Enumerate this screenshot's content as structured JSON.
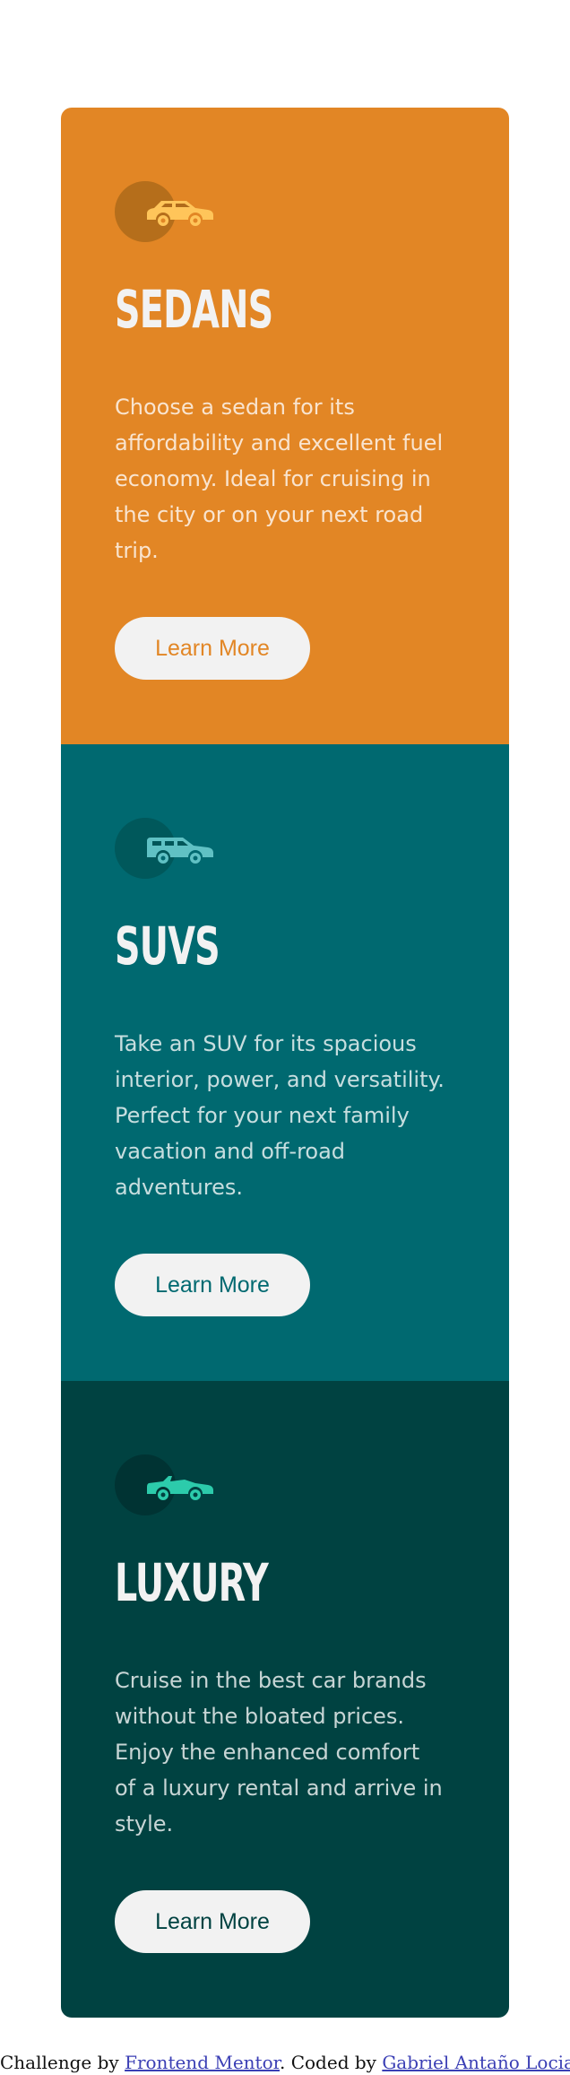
{
  "cards": [
    {
      "title": "SEDANS",
      "text": "Choose a sedan for its affordability and excellent fuel economy. Ideal for cruising in the city or on your next road trip.",
      "button_label": "Learn More",
      "icon": "sedan-icon",
      "accent_color": "#e28625"
    },
    {
      "title": "SUVS",
      "text": "Take an SUV for its spacious interior, power, and versatility. Perfect for your next family vacation and off-road adventures.",
      "button_label": "Learn More",
      "icon": "suv-icon",
      "accent_color": "#006970"
    },
    {
      "title": "LUXURY",
      "text": "Cruise in the best car brands without the bloated prices. Enjoy the enhanced comfort of a luxury rental and arrive in style.",
      "button_label": "Learn More",
      "icon": "luxury-car-icon",
      "accent_color": "#004241"
    }
  ],
  "attribution": {
    "prefix": "Challenge by ",
    "link1": "Frontend Mentor",
    "middle": ". Coded by ",
    "link2": "Gabriel Antaño Locia",
    "suffix": "."
  },
  "colors": {
    "background": "#ffffff",
    "button_background": "#f2f2f2",
    "link": "#3b3fb5"
  }
}
